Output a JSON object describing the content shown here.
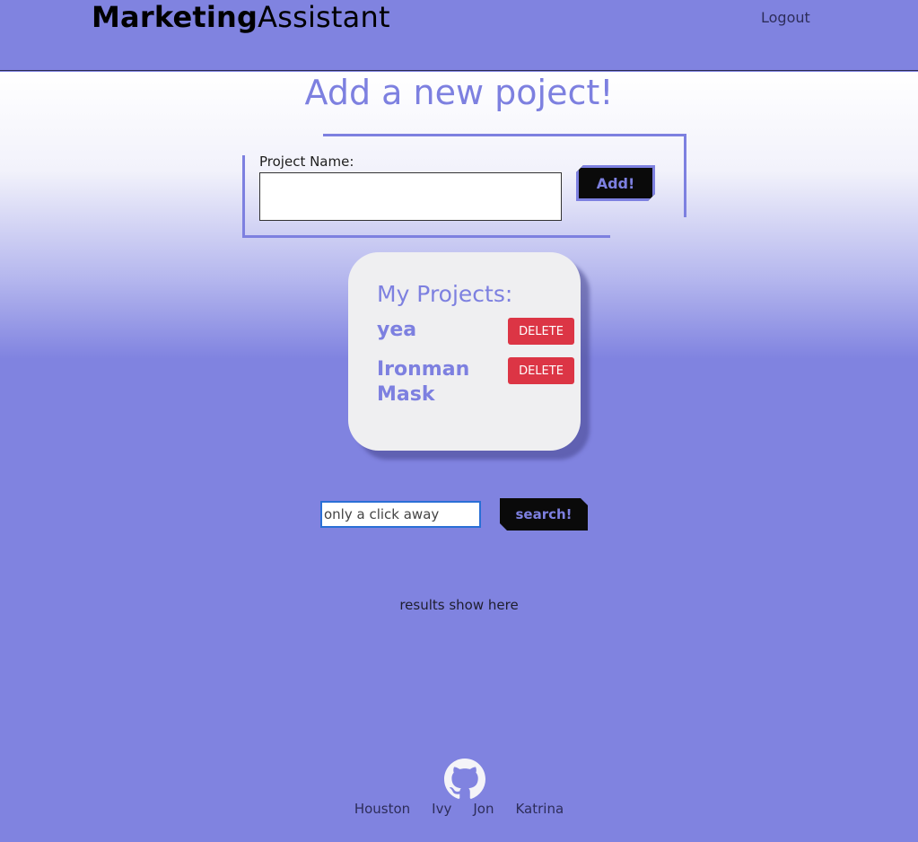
{
  "header": {
    "brand_bold": "Marketing",
    "brand_light": "Assistant",
    "logout_label": "Logout"
  },
  "add_project": {
    "title": "Add a new poject!",
    "label": "Project Name:",
    "input_value": "",
    "button_label": "Add!"
  },
  "projects": {
    "heading": "My Projects:",
    "items": [
      {
        "name": "yea",
        "delete_label": "DELETE"
      },
      {
        "name": "Ironman Mask",
        "delete_label": "DELETE"
      }
    ]
  },
  "search": {
    "placeholder": "only a click away",
    "button_label": "search!",
    "results_text": "results show here"
  },
  "footer": {
    "icon": "github-icon",
    "links": [
      "Houston",
      "Ivy",
      "Jon",
      "Katrina"
    ]
  },
  "colors": {
    "accent": "#7d80e0",
    "background": "#8083e0",
    "delete": "#dc3545"
  }
}
